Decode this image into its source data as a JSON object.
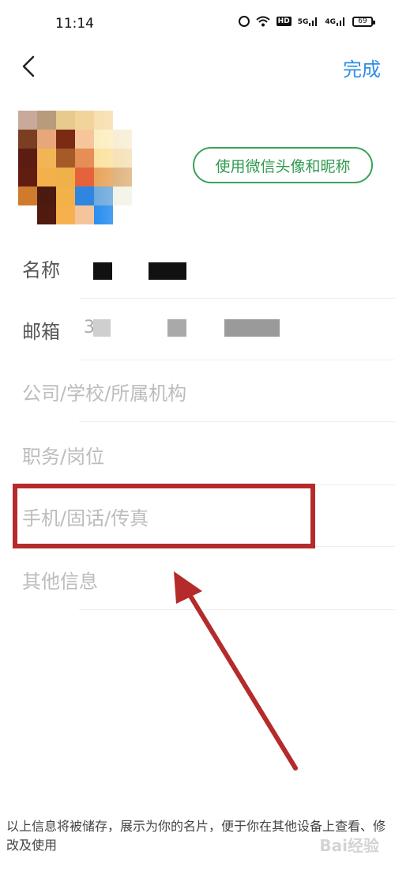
{
  "status_bar": {
    "time": "11:14",
    "icons": [
      "alarm-icon",
      "wifi-icon",
      "hd-icon",
      "5g-signal-icon",
      "4g-signal-icon",
      "battery-icon"
    ],
    "hd_label": "HD",
    "sig5_label": "5G",
    "sig4_label": "4G",
    "battery": "69"
  },
  "header": {
    "back_icon": "chevron-left-icon",
    "done_label": "完成",
    "accent_color": "#2f8ee6"
  },
  "profile": {
    "wechat_button_label": "使用微信头像和昵称",
    "wechat_color": "#3aa35a"
  },
  "form": {
    "name_label": "名称",
    "email_label": "邮箱",
    "email_prefix": "3",
    "org_placeholder": "公司/学校/所属机构",
    "position_placeholder": "职务/岗位",
    "phone_placeholder": "手机/固话/传真",
    "other_placeholder": "其他信息"
  },
  "annotation": {
    "highlight_color": "#b52a2a"
  },
  "footer": {
    "note": "以上信息将被储存，展示为你的名片，便于你在其他设备上查看、修改及使用"
  },
  "watermark": "Bai经验"
}
